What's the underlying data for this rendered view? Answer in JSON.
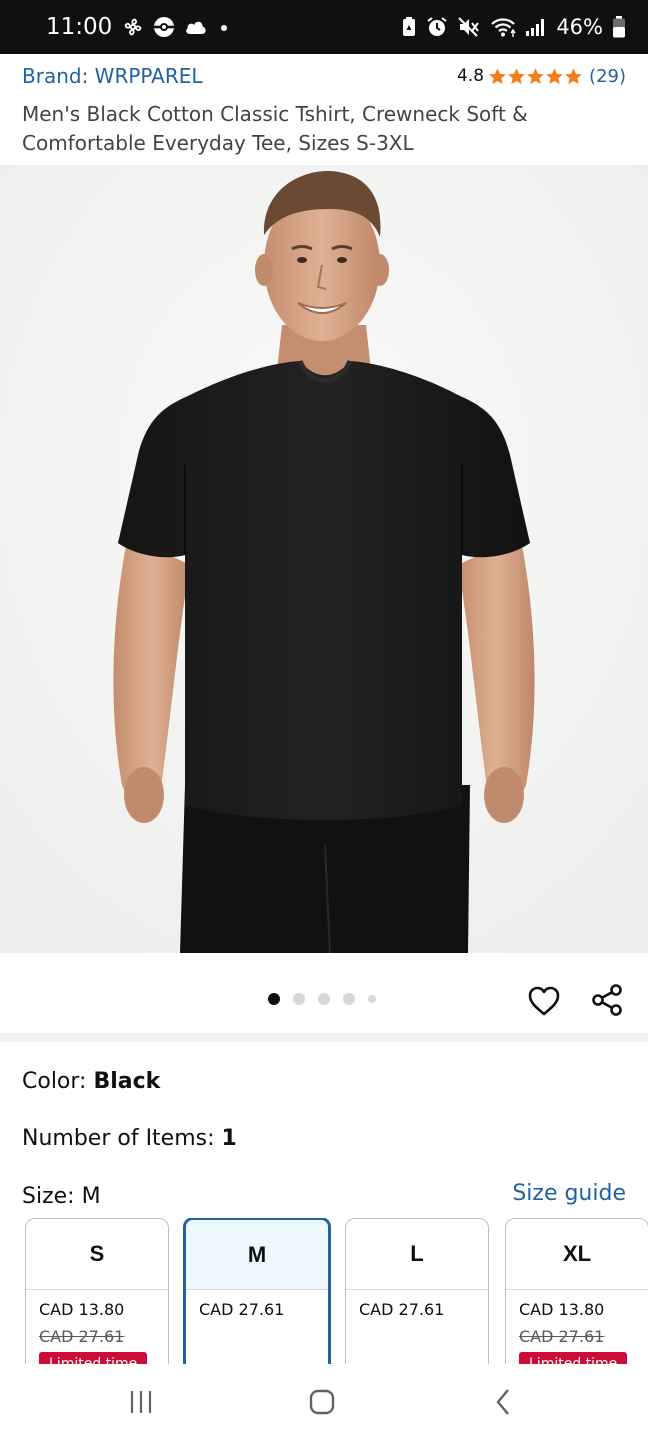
{
  "status_bar": {
    "time": "11:00",
    "battery": "46%",
    "left_icons": [
      "fan-icon",
      "pokeball-icon",
      "cloud-icon",
      "dot-icon"
    ],
    "right_icons": [
      "lock-battery-icon",
      "alarm-icon",
      "mute-icon",
      "wifi-icon",
      "signal-icon",
      "battery-icon"
    ]
  },
  "product": {
    "brand_label": "Brand: WRPPAREL",
    "rating_value": "4.8",
    "rating_count": "(29)",
    "stars": 5,
    "star_color": "#f47d1b",
    "title": "Men's Black Cotton Classic Tshirt, Crewneck Soft & Comfortable Everyday Tee, Sizes S-3XL"
  },
  "carousel": {
    "total_images": 5,
    "active_index": 0
  },
  "variations": {
    "color_label": "Color: ",
    "color_value": "Black",
    "items_label": "Number of Items: ",
    "items_value": "1",
    "size_label": "Size: ",
    "size_value": "M",
    "size_guide": "Size guide"
  },
  "sizes": [
    {
      "size": "S",
      "price": "CAD 13.80",
      "was": "CAD 27.61",
      "badge": "Limited time",
      "selected": false
    },
    {
      "size": "M",
      "price": "CAD 27.61",
      "was": "",
      "badge": "",
      "selected": true
    },
    {
      "size": "L",
      "price": "CAD 27.61",
      "was": "",
      "badge": "",
      "selected": false
    },
    {
      "size": "XL",
      "price": "CAD 13.80",
      "was": "CAD 27.61",
      "badge": "Limited time",
      "selected": false
    }
  ],
  "colors": {
    "link": "#2162a1",
    "deal": "#cc0c39",
    "selected_border": "#2162a1",
    "status_bar_bg": "#0f1111"
  },
  "nav": [
    "recent-apps-icon",
    "home-icon",
    "back-icon"
  ]
}
